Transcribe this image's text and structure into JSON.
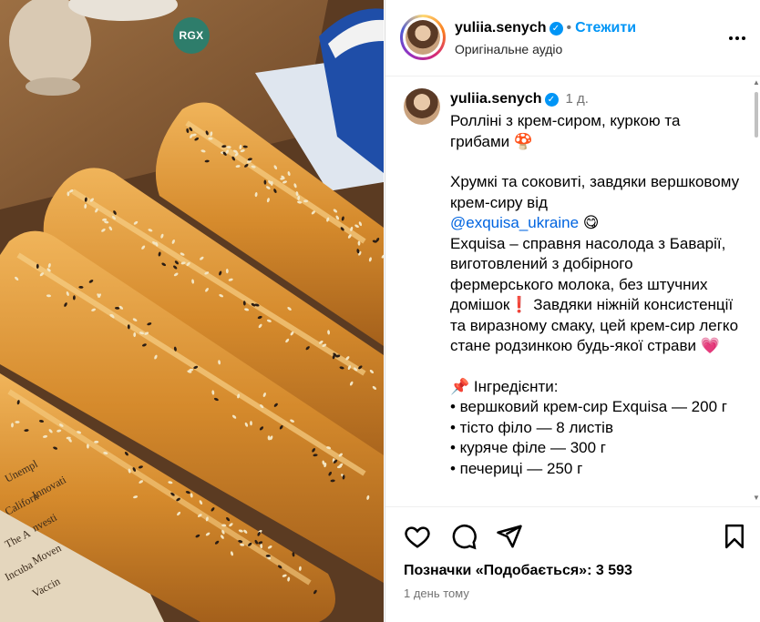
{
  "photo": {
    "badge": "RGX",
    "newspaper_words": [
      "Unempl",
      "Innovati",
      "Californ",
      "nvesti",
      "The A",
      "Moven",
      "Incuba",
      "Vaccin"
    ]
  },
  "header": {
    "username": "yuliia.senych",
    "separator": "•",
    "follow_label": "Стежити",
    "audio": "Оригінальне аудіо",
    "more_icon": "more-horizontal-icon"
  },
  "caption": {
    "username": "yuliia.senych",
    "time": "1 д.",
    "lines": [
      "Ролліні з крем-сиром, куркою та грибами 🍄",
      "",
      "Хрумкі та соковиті, завдяки вершковому крем-сиру від",
      "@exquisa_ukraine",
      " 😋",
      "Exquisa – справня насолода з Баварії, виготовлений з добірного фермерського молока, без штучних домішок❗ Завдяки ніжній консистенції та виразному смаку, цей крем-сир легко стане родзинкою будь-якої страви 💗",
      "",
      "📌 Інгредієнти:",
      "• вершковий крем-сир Exquisa — 200 г",
      "• тісто філо — 8 листів",
      "• куряче філе — 300 г",
      "• печериці — 250 г"
    ]
  },
  "actions": {
    "icons": [
      "heart-icon",
      "comment-icon",
      "share-icon",
      "bookmark-icon"
    ],
    "likes": "Позначки «Подобається»: 3 593",
    "timestamp": "1 день тому"
  },
  "colors": {
    "accent": "#0095f6",
    "mention": "#0064e0",
    "muted": "#737373"
  }
}
